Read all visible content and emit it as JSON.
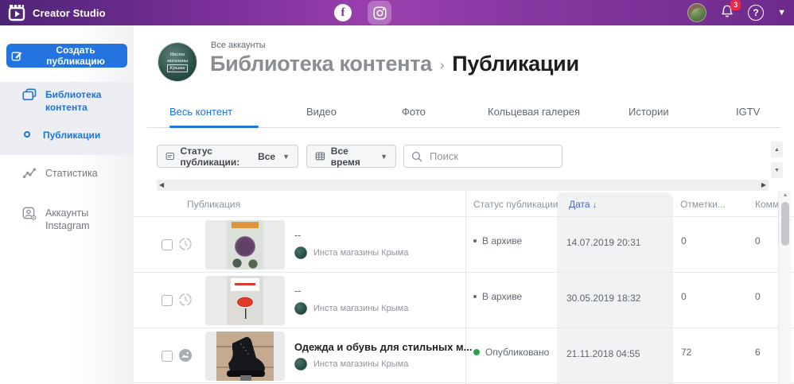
{
  "topbar": {
    "app_name": "Creator Studio",
    "notification_badge": "3"
  },
  "glyphs": {
    "facebook_f": "f",
    "help": "?",
    "caret_down": "▼",
    "dropdown_tri": "▼",
    "arrow_up": "▲",
    "arrow_down": "▼",
    "arrow_left": "◀",
    "arrow_right": "▶",
    "sort_down": "↓"
  },
  "sidebar": {
    "create_button_label": "Создать публикацию",
    "items": [
      {
        "label": "Библиотека контента"
      },
      {
        "label": "Публикации"
      },
      {
        "label": "Статистика"
      },
      {
        "label": "Аккаунты Instagram"
      }
    ]
  },
  "header": {
    "scope_label": "Все аккаунты",
    "breadcrumb_parent": "Библиотека контента",
    "breadcrumb_separator": "›",
    "page_title": "Публикации",
    "avatar_line1": "Инста",
    "avatar_line2": "магазины",
    "avatar_line3": "Крыма"
  },
  "tabs": [
    {
      "label": "Весь контент"
    },
    {
      "label": "Видео"
    },
    {
      "label": "Фото"
    },
    {
      "label": "Кольцевая галерея"
    },
    {
      "label": "Истории"
    },
    {
      "label": "IGTV"
    }
  ],
  "filters": {
    "status_label": "Статус публикации:",
    "status_value": "Все",
    "time_value": "Все время",
    "search_placeholder": "Поиск"
  },
  "table": {
    "col_publication": "Публикация",
    "col_status": "Статус публикации",
    "col_date": "Дата",
    "col_likes": "Отметки...",
    "col_comments": "Комм",
    "rows": [
      {
        "title": "--",
        "account": "Инста магазины Крыма",
        "status": "В архиве",
        "date": "14.07.2019 20:31",
        "likes": "0",
        "comments": "0"
      },
      {
        "title": "--",
        "account": "Инста магазины Крыма",
        "status": "В архиве",
        "date": "30.05.2019 18:32",
        "likes": "0",
        "comments": "0"
      },
      {
        "title": "Одежда и обувь для стильных м...",
        "account": "Инста магазины Крыма",
        "status": "Опубликовано",
        "date": "21.11.2018 04:55",
        "likes": "72",
        "comments": "6"
      }
    ]
  },
  "colors": {
    "topbar_purple": "#8a3aa2",
    "accent_blue": "#2374e1",
    "sort_blue": "#4267d2",
    "status_green": "#31a24c",
    "status_gray": "#606770",
    "badge_red": "#f02849"
  }
}
